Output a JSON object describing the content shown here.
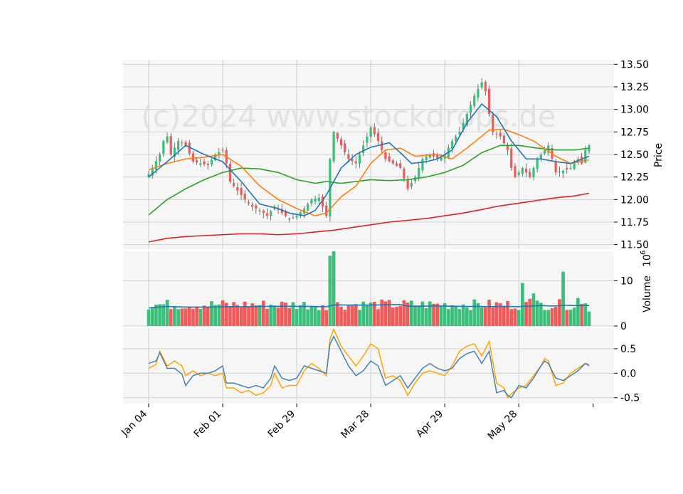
{
  "chart_data": {
    "type": "candlestick",
    "watermark": "(c)2024 www.stockdrops.de",
    "x_tick_labels": [
      "Jan 04",
      "Feb 01",
      "Feb 29",
      "Mar 28",
      "Apr 29",
      "May 28"
    ],
    "x_tick_index": [
      0,
      20,
      40,
      60,
      80,
      100
    ],
    "price_panel": {
      "ylabel": "Price",
      "ylim": [
        11.45,
        13.55
      ],
      "yticks": [
        "13.50",
        "13.25",
        "13.00",
        "12.75",
        "12.50",
        "12.25",
        "12.00",
        "11.75",
        "11.50"
      ],
      "ytick_values": [
        13.5,
        13.25,
        13.0,
        12.75,
        12.5,
        12.25,
        12.0,
        11.75,
        11.5
      ],
      "up_color": "#3bbf7a",
      "down_color": "#f25a5a",
      "ma_colors": [
        "#1f77b4",
        "#ff7f0e",
        "#2ca02c",
        "#d62728"
      ],
      "ma_anchor_points": {
        "blue": [
          [
            0,
            12.25
          ],
          [
            5,
            12.42
          ],
          [
            10,
            12.6
          ],
          [
            15,
            12.5
          ],
          [
            20,
            12.42
          ],
          [
            25,
            12.2
          ],
          [
            30,
            11.95
          ],
          [
            35,
            11.9
          ],
          [
            38,
            11.85
          ],
          [
            42,
            11.82
          ],
          [
            45,
            11.88
          ],
          [
            48,
            12.05
          ],
          [
            52,
            12.35
          ],
          [
            56,
            12.5
          ],
          [
            60,
            12.58
          ],
          [
            65,
            12.63
          ],
          [
            68,
            12.52
          ],
          [
            71,
            12.4
          ],
          [
            75,
            12.42
          ],
          [
            78,
            12.45
          ],
          [
            82,
            12.55
          ],
          [
            86,
            12.85
          ],
          [
            90,
            13.06
          ],
          [
            94,
            12.92
          ],
          [
            98,
            12.65
          ],
          [
            102,
            12.45
          ],
          [
            106,
            12.45
          ],
          [
            110,
            12.42
          ],
          [
            114,
            12.4
          ],
          [
            119,
            12.48
          ]
        ],
        "orange": [
          [
            0,
            12.33
          ],
          [
            5,
            12.4
          ],
          [
            10,
            12.45
          ],
          [
            15,
            12.47
          ],
          [
            20,
            12.5
          ],
          [
            25,
            12.37
          ],
          [
            30,
            12.15
          ],
          [
            35,
            12.0
          ],
          [
            40,
            11.9
          ],
          [
            45,
            11.82
          ],
          [
            48,
            11.85
          ],
          [
            52,
            12.03
          ],
          [
            56,
            12.15
          ],
          [
            60,
            12.4
          ],
          [
            64,
            12.55
          ],
          [
            68,
            12.57
          ],
          [
            72,
            12.48
          ],
          [
            78,
            12.5
          ],
          [
            82,
            12.45
          ],
          [
            86,
            12.57
          ],
          [
            92,
            12.77
          ],
          [
            96,
            12.78
          ],
          [
            100,
            12.72
          ],
          [
            104,
            12.65
          ],
          [
            110,
            12.48
          ],
          [
            114,
            12.4
          ],
          [
            119,
            12.44
          ]
        ],
        "green": [
          [
            0,
            11.83
          ],
          [
            5,
            12.0
          ],
          [
            10,
            12.12
          ],
          [
            15,
            12.22
          ],
          [
            20,
            12.3
          ],
          [
            25,
            12.35
          ],
          [
            30,
            12.34
          ],
          [
            35,
            12.3
          ],
          [
            40,
            12.22
          ],
          [
            45,
            12.18
          ],
          [
            48,
            12.2
          ],
          [
            52,
            12.18
          ],
          [
            56,
            12.2
          ],
          [
            60,
            12.22
          ],
          [
            65,
            12.21
          ],
          [
            70,
            12.22
          ],
          [
            75,
            12.25
          ],
          [
            80,
            12.3
          ],
          [
            85,
            12.38
          ],
          [
            90,
            12.52
          ],
          [
            95,
            12.6
          ],
          [
            100,
            12.6
          ],
          [
            105,
            12.57
          ],
          [
            110,
            12.55
          ],
          [
            115,
            12.55
          ],
          [
            119,
            12.57
          ]
        ],
        "red": [
          [
            0,
            11.53
          ],
          [
            5,
            11.57
          ],
          [
            10,
            11.59
          ],
          [
            15,
            11.6
          ],
          [
            20,
            11.61
          ],
          [
            25,
            11.62
          ],
          [
            30,
            11.62
          ],
          [
            35,
            11.61
          ],
          [
            40,
            11.62
          ],
          [
            45,
            11.64
          ],
          [
            50,
            11.66
          ],
          [
            55,
            11.69
          ],
          [
            60,
            11.72
          ],
          [
            65,
            11.75
          ],
          [
            70,
            11.77
          ],
          [
            75,
            11.79
          ],
          [
            80,
            11.82
          ],
          [
            85,
            11.85
          ],
          [
            90,
            11.89
          ],
          [
            95,
            11.93
          ],
          [
            100,
            11.96
          ],
          [
            105,
            11.99
          ],
          [
            110,
            12.02
          ],
          [
            115,
            12.04
          ],
          [
            119,
            12.07
          ]
        ]
      },
      "close_anchor_points": [
        [
          0,
          12.28
        ],
        [
          3,
          12.5
        ],
        [
          4,
          12.65
        ],
        [
          5,
          12.7
        ],
        [
          6,
          12.5
        ],
        [
          8,
          12.65
        ],
        [
          10,
          12.6
        ],
        [
          12,
          12.42
        ],
        [
          14,
          12.4
        ],
        [
          16,
          12.38
        ],
        [
          18,
          12.5
        ],
        [
          20,
          12.55
        ],
        [
          21,
          12.4
        ],
        [
          22,
          12.2
        ],
        [
          24,
          12.1
        ],
        [
          26,
          12.0
        ],
        [
          28,
          11.92
        ],
        [
          30,
          11.88
        ],
        [
          32,
          11.82
        ],
        [
          34,
          11.92
        ],
        [
          36,
          11.85
        ],
        [
          38,
          11.78
        ],
        [
          40,
          11.82
        ],
        [
          42,
          11.9
        ],
        [
          44,
          12.0
        ],
        [
          46,
          12.02
        ],
        [
          48,
          11.82
        ],
        [
          49,
          12.45
        ],
        [
          50,
          12.75
        ],
        [
          52,
          12.6
        ],
        [
          54,
          12.45
        ],
        [
          56,
          12.4
        ],
        [
          58,
          12.6
        ],
        [
          60,
          12.8
        ],
        [
          62,
          12.65
        ],
        [
          64,
          12.45
        ],
        [
          66,
          12.4
        ],
        [
          68,
          12.35
        ],
        [
          70,
          12.12
        ],
        [
          72,
          12.25
        ],
        [
          74,
          12.45
        ],
        [
          76,
          12.5
        ],
        [
          78,
          12.45
        ],
        [
          80,
          12.5
        ],
        [
          82,
          12.65
        ],
        [
          84,
          12.75
        ],
        [
          86,
          12.95
        ],
        [
          88,
          13.15
        ],
        [
          90,
          13.3
        ],
        [
          91,
          13.2
        ],
        [
          92,
          12.95
        ],
        [
          93,
          12.75
        ],
        [
          95,
          12.7
        ],
        [
          97,
          12.55
        ],
        [
          98,
          12.35
        ],
        [
          99,
          12.25
        ],
        [
          101,
          12.35
        ],
        [
          103,
          12.25
        ],
        [
          105,
          12.45
        ],
        [
          107,
          12.55
        ],
        [
          108,
          12.6
        ],
        [
          110,
          12.3
        ],
        [
          112,
          12.32
        ],
        [
          114,
          12.35
        ],
        [
          116,
          12.45
        ],
        [
          117,
          12.4
        ],
        [
          118,
          12.55
        ],
        [
          119,
          12.6
        ]
      ]
    },
    "volume_panel": {
      "ylabel": "Volume",
      "multiplier_label": "10",
      "multiplier_exp": "6",
      "ylim": [
        0,
        16.5
      ],
      "yticks": [
        "10",
        "0"
      ],
      "ytick_values": [
        10,
        0
      ],
      "ma_color": "#1f77b4",
      "spikes": [
        [
          48,
          3.5
        ],
        [
          49,
          15.5
        ],
        [
          50,
          16.5
        ],
        [
          101,
          9.5
        ],
        [
          103,
          6
        ],
        [
          104,
          7.2
        ],
        [
          112,
          12
        ],
        [
          116,
          6.2
        ],
        [
          119,
          3.2
        ]
      ],
      "base_level": 4.6
    },
    "oscillator_panel": {
      "ylim": [
        -0.62,
        0.92
      ],
      "yticks": [
        "0.5",
        "0.0",
        "-0.5"
      ],
      "ytick_values": [
        0.5,
        0.0,
        -0.5
      ],
      "series_colors": [
        "#4682b4",
        "#ffa500"
      ],
      "blue_anchor_points": [
        [
          0,
          0.2
        ],
        [
          2,
          0.25
        ],
        [
          3,
          0.42
        ],
        [
          5,
          0.1
        ],
        [
          7,
          0.1
        ],
        [
          9,
          -0.02
        ],
        [
          10,
          -0.25
        ],
        [
          12,
          -0.05
        ],
        [
          14,
          0.0
        ],
        [
          16,
          0.0
        ],
        [
          18,
          0.05
        ],
        [
          20,
          0.15
        ],
        [
          21,
          -0.2
        ],
        [
          23,
          -0.2
        ],
        [
          25,
          -0.25
        ],
        [
          27,
          -0.3
        ],
        [
          29,
          -0.25
        ],
        [
          31,
          -0.3
        ],
        [
          33,
          -0.1
        ],
        [
          34,
          0.15
        ],
        [
          36,
          -0.1
        ],
        [
          38,
          -0.15
        ],
        [
          40,
          -0.1
        ],
        [
          42,
          0.15
        ],
        [
          44,
          0.1
        ],
        [
          46,
          0.05
        ],
        [
          48,
          0.0
        ],
        [
          49,
          0.6
        ],
        [
          50,
          0.75
        ],
        [
          52,
          0.45
        ],
        [
          54,
          0.15
        ],
        [
          56,
          -0.05
        ],
        [
          58,
          0.05
        ],
        [
          60,
          0.25
        ],
        [
          62,
          0.15
        ],
        [
          64,
          -0.25
        ],
        [
          66,
          -0.15
        ],
        [
          68,
          -0.05
        ],
        [
          70,
          -0.3
        ],
        [
          72,
          -0.1
        ],
        [
          74,
          0.1
        ],
        [
          76,
          0.2
        ],
        [
          78,
          0.1
        ],
        [
          80,
          0.05
        ],
        [
          82,
          0.1
        ],
        [
          84,
          0.3
        ],
        [
          86,
          0.4
        ],
        [
          88,
          0.45
        ],
        [
          90,
          0.2
        ],
        [
          92,
          0.45
        ],
        [
          94,
          -0.4
        ],
        [
          96,
          -0.35
        ],
        [
          97,
          -0.45
        ],
        [
          98,
          -0.5
        ],
        [
          100,
          -0.25
        ],
        [
          102,
          -0.3
        ],
        [
          104,
          -0.1
        ],
        [
          106,
          0.15
        ],
        [
          107,
          0.25
        ],
        [
          108,
          0.2
        ],
        [
          110,
          -0.1
        ],
        [
          112,
          -0.15
        ],
        [
          114,
          -0.05
        ],
        [
          116,
          0.05
        ],
        [
          118,
          0.2
        ],
        [
          119,
          0.15
        ]
      ],
      "orange_anchor_points": [
        [
          0,
          0.1
        ],
        [
          2,
          0.18
        ],
        [
          3,
          0.45
        ],
        [
          5,
          0.15
        ],
        [
          7,
          0.25
        ],
        [
          9,
          0.15
        ],
        [
          10,
          -0.05
        ],
        [
          12,
          0.05
        ],
        [
          14,
          -0.05
        ],
        [
          16,
          0.0
        ],
        [
          18,
          -0.05
        ],
        [
          20,
          0.0
        ],
        [
          21,
          -0.3
        ],
        [
          23,
          -0.3
        ],
        [
          25,
          -0.4
        ],
        [
          27,
          -0.35
        ],
        [
          29,
          -0.45
        ],
        [
          31,
          -0.4
        ],
        [
          33,
          -0.25
        ],
        [
          34,
          0.0
        ],
        [
          36,
          -0.3
        ],
        [
          38,
          -0.25
        ],
        [
          40,
          -0.25
        ],
        [
          42,
          0.05
        ],
        [
          44,
          0.2
        ],
        [
          46,
          0.1
        ],
        [
          48,
          -0.05
        ],
        [
          49,
          0.7
        ],
        [
          50,
          0.9
        ],
        [
          52,
          0.55
        ],
        [
          54,
          0.35
        ],
        [
          56,
          0.15
        ],
        [
          58,
          0.35
        ],
        [
          60,
          0.6
        ],
        [
          62,
          0.5
        ],
        [
          64,
          -0.1
        ],
        [
          66,
          -0.05
        ],
        [
          68,
          -0.15
        ],
        [
          70,
          -0.45
        ],
        [
          72,
          -0.2
        ],
        [
          74,
          0.0
        ],
        [
          76,
          0.05
        ],
        [
          78,
          0.0
        ],
        [
          80,
          -0.05
        ],
        [
          82,
          0.15
        ],
        [
          84,
          0.45
        ],
        [
          86,
          0.55
        ],
        [
          88,
          0.6
        ],
        [
          90,
          0.35
        ],
        [
          92,
          0.65
        ],
        [
          94,
          -0.2
        ],
        [
          96,
          -0.3
        ],
        [
          97,
          -0.5
        ],
        [
          98,
          -0.42
        ],
        [
          100,
          -0.3
        ],
        [
          102,
          -0.25
        ],
        [
          104,
          -0.05
        ],
        [
          106,
          0.15
        ],
        [
          107,
          0.3
        ],
        [
          108,
          0.25
        ],
        [
          110,
          -0.25
        ],
        [
          112,
          -0.2
        ],
        [
          114,
          0.0
        ],
        [
          116,
          0.1
        ],
        [
          118,
          0.2
        ],
        [
          119,
          0.18
        ]
      ]
    }
  }
}
